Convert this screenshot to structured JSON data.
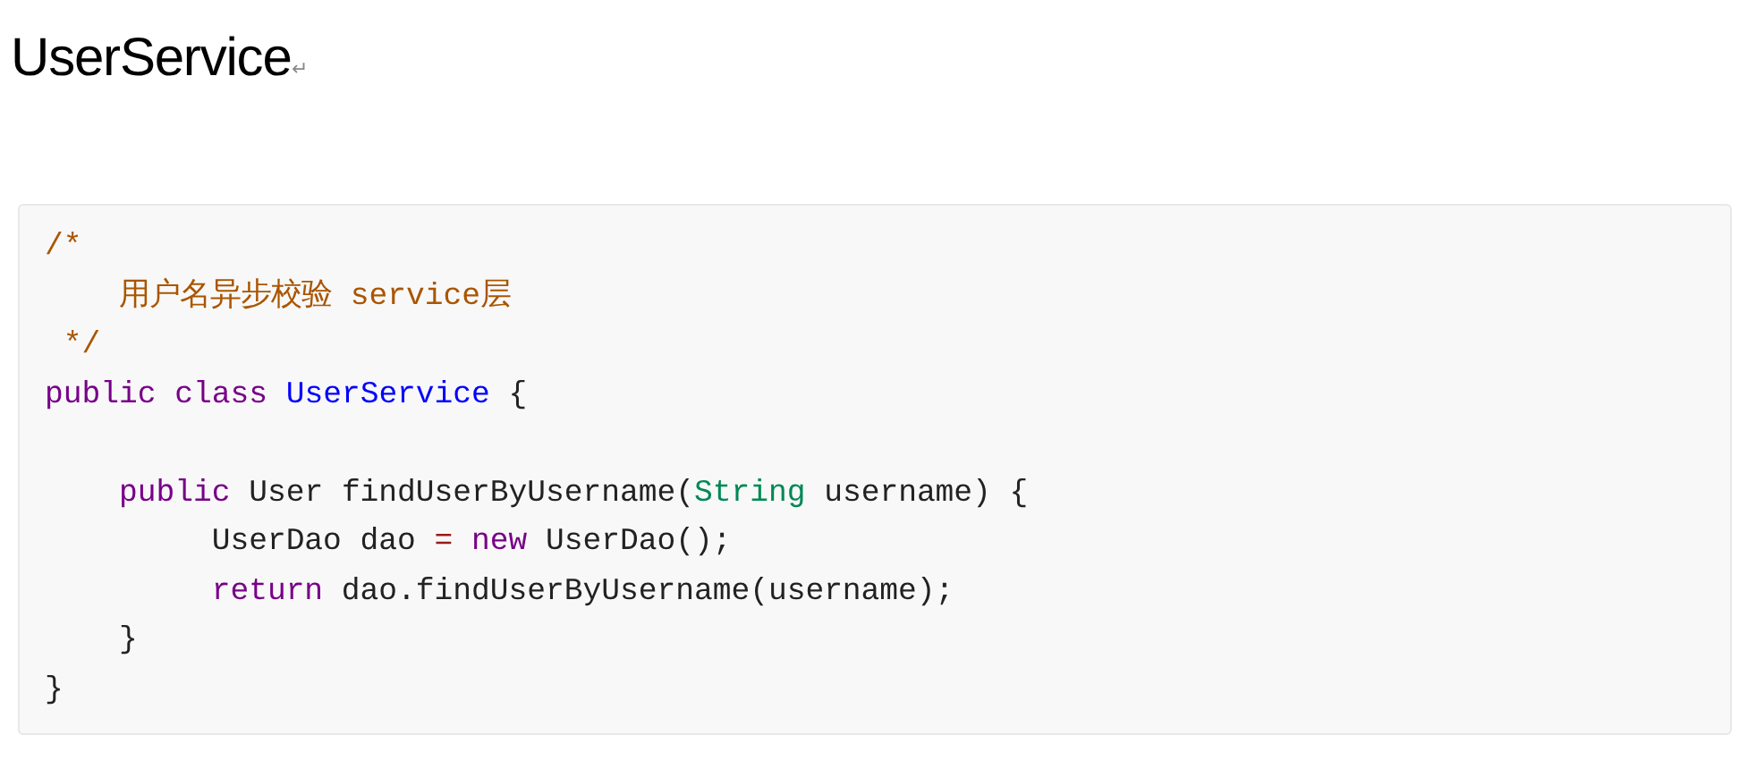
{
  "heading": {
    "text": "UserService",
    "paragraph_mark": "↵"
  },
  "code_block": {
    "lines": [
      {
        "kind": "code",
        "tokens": [
          {
            "kind": "comment",
            "text": "/*"
          }
        ]
      },
      {
        "kind": "code",
        "tokens": [
          {
            "kind": "comment",
            "text": "    用户名异步校验 service层"
          }
        ]
      },
      {
        "kind": "code",
        "tokens": [
          {
            "kind": "comment",
            "text": " */"
          }
        ]
      },
      {
        "kind": "code",
        "tokens": [
          {
            "kind": "keyword",
            "text": "public"
          },
          {
            "kind": "keyword",
            "text": " class"
          },
          {
            "kind": "def",
            "text": " UserService"
          },
          {
            "kind": "plain",
            "text": " {"
          }
        ]
      },
      {
        "kind": "blank"
      },
      {
        "kind": "code",
        "tokens": [
          {
            "kind": "keyword",
            "text": "    public"
          },
          {
            "kind": "plain",
            "text": " User findUserByUsername("
          },
          {
            "kind": "type",
            "text": "String"
          },
          {
            "kind": "plain",
            "text": " username) {"
          }
        ]
      },
      {
        "kind": "code",
        "tokens": [
          {
            "kind": "plain",
            "text": "         UserDao dao"
          },
          {
            "kind": "operator",
            "text": " ="
          },
          {
            "kind": "keyword",
            "text": " new"
          },
          {
            "kind": "plain",
            "text": " UserDao();"
          }
        ]
      },
      {
        "kind": "code",
        "tokens": [
          {
            "kind": "keyword",
            "text": "         return"
          },
          {
            "kind": "plain",
            "text": " dao.findUserByUsername(username);"
          }
        ]
      },
      {
        "kind": "code",
        "tokens": [
          {
            "kind": "plain",
            "text": "    }"
          }
        ]
      },
      {
        "kind": "code",
        "tokens": [
          {
            "kind": "plain",
            "text": "}"
          }
        ]
      }
    ]
  }
}
